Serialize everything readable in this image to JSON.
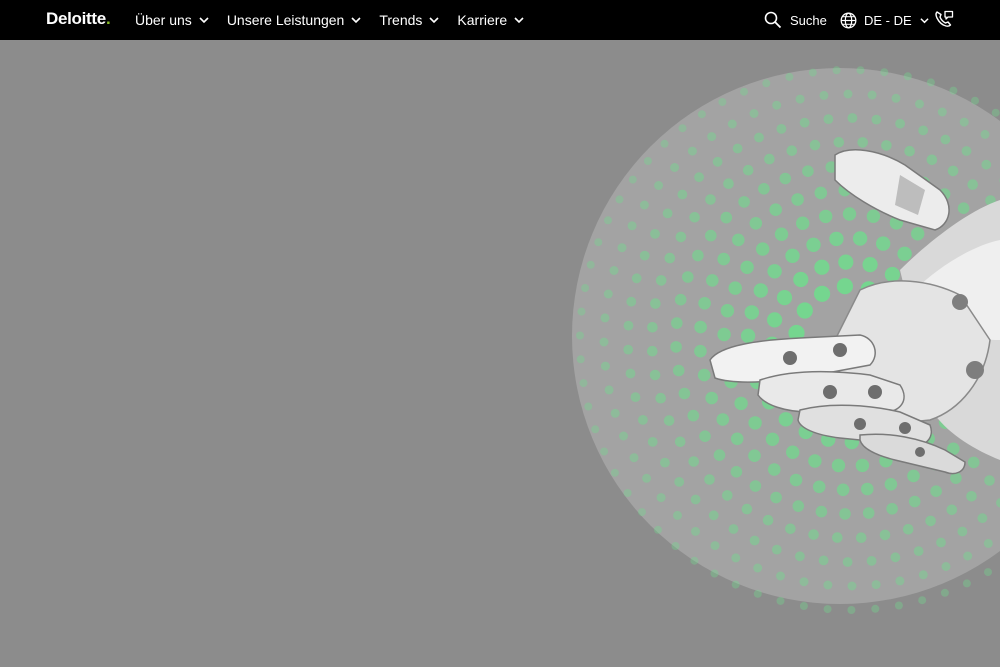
{
  "header": {
    "logo_text": "Deloitte",
    "logo_dot": ".",
    "nav_items": [
      {
        "label": "Über uns"
      },
      {
        "label": "Unsere Leistungen"
      },
      {
        "label": "Trends"
      },
      {
        "label": "Karriere"
      }
    ],
    "search_label": "Suche",
    "language_label": "DE - DE"
  },
  "icons": {
    "search": "search-icon",
    "globe": "globe-icon",
    "contact": "phone-icon",
    "chevron": "chevron-down-icon"
  },
  "colors": {
    "header_bg": "#000000",
    "page_overlay": "#8c8c8c",
    "circle": "#a3a3a3",
    "brand_green": "#86bc25",
    "dot_green": "#6fdc8c"
  }
}
